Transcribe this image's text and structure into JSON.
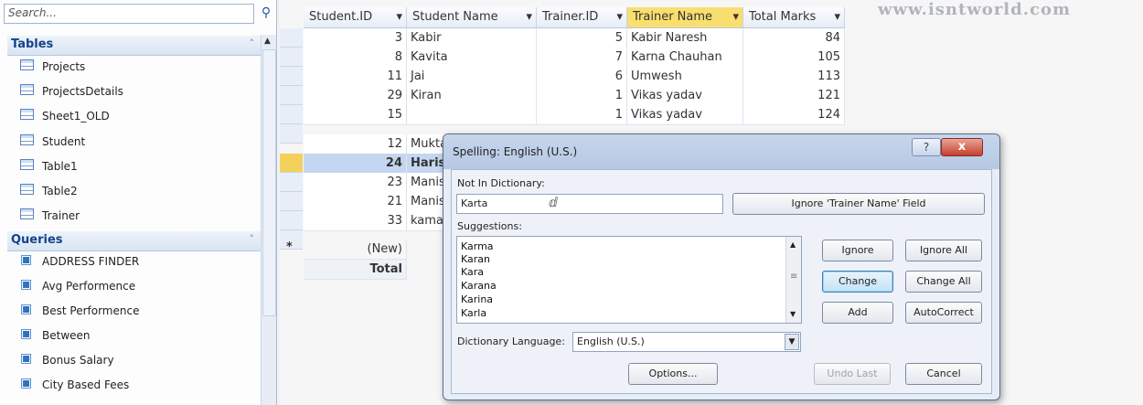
{
  "nav": {
    "search_placeholder": "Search...",
    "tables_header": "Tables",
    "tables": [
      "Projects",
      "ProjectsDetails",
      "Sheet1_OLD",
      "Student",
      "Table1",
      "Table2",
      "Trainer"
    ],
    "queries_header": "Queries",
    "queries": [
      "ADDRESS FINDER",
      "Avg Performence",
      "Best Performence",
      "Between",
      "Bonus Salary",
      "City Based Fees"
    ]
  },
  "sheet": {
    "headers": [
      "Student.ID",
      "Student Name",
      "Trainer.ID",
      "Trainer Name",
      "Total Marks"
    ],
    "rows": [
      [
        "3",
        "Kabir",
        "5",
        "Kabir Naresh",
        "84"
      ],
      [
        "8",
        "Kavita",
        "7",
        "Karna Chauhan",
        "105"
      ],
      [
        "11",
        "Jai",
        "6",
        "Umwesh",
        "113"
      ],
      [
        "29",
        "Kiran",
        "1",
        "Vikas yadav",
        "121"
      ],
      [
        "15",
        "",
        "1",
        "Vikas yadav",
        "124"
      ],
      [
        "12",
        "Mukta",
        "",
        "",
        ""
      ],
      [
        "24",
        "Harish",
        "",
        "",
        ""
      ],
      [
        "23",
        "Manis",
        "",
        "",
        ""
      ],
      [
        "21",
        "Manis",
        "",
        "",
        ""
      ],
      [
        "33",
        "kamal",
        "",
        "",
        ""
      ]
    ],
    "new_row_marker": "*",
    "new_row_label": "(New)",
    "total_label": "Total",
    "watermark": "www.isntworld.com"
  },
  "dialog": {
    "title": "Spelling: English (U.S.)",
    "help_label": "?",
    "close_label": "x",
    "not_in_dictionary_label": "Not In Dictionary:",
    "not_in_dictionary_value": "Karta",
    "ignore_field_label": "Ignore 'Trainer Name' Field",
    "suggestions_label": "Suggestions:",
    "suggestions": [
      "Karma",
      "Karan",
      "Kara",
      "Karana",
      "Karina",
      "Karla"
    ],
    "ignore_label": "Ignore",
    "ignore_all_label": "Ignore All",
    "change_label": "Change",
    "change_all_label": "Change All",
    "add_label": "Add",
    "autocorrect_label": "AutoCorrect",
    "dictionary_language_label": "Dictionary Language:",
    "dictionary_language_value": "English (U.S.)",
    "options_label": "Options...",
    "undo_last_label": "Undo Last",
    "cancel_label": "Cancel"
  },
  "colors": {
    "selected_header": "#f8df6f",
    "selected_row": "#c5d7f0",
    "nav_header_text": "#15428b"
  }
}
